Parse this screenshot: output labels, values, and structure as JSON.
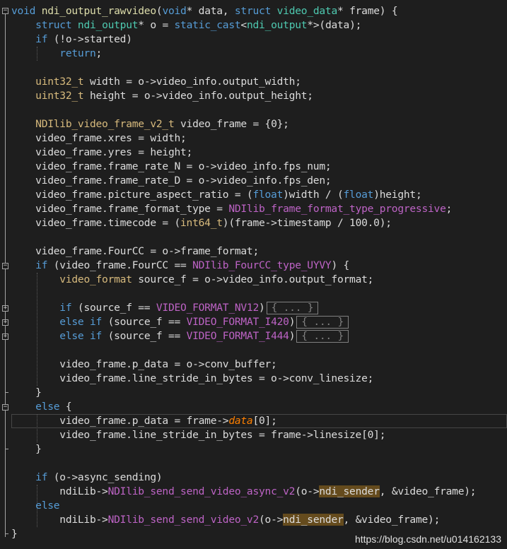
{
  "colors": {
    "background": "#1e1e1e",
    "keyword": "#569cd6",
    "type": "#4ec9b0",
    "function": "#dcdcaa",
    "member": "#dadada",
    "enum_constant": "#b8d7a3",
    "macro": "#bd63c5",
    "highlight": "#654b1d"
  },
  "icons": {
    "fold_expanded": "minus-square-icon",
    "fold_collapsed": "plus-square-icon"
  },
  "fold_glyphs": {
    "expanded": "−",
    "collapsed": "+"
  },
  "code": {
    "l1": {
      "a": "void",
      "b": " ndi_output_rawvideo",
      "c": "(",
      "d": "void",
      "e": "* data, ",
      "f": "struct",
      "g": " video_data",
      "h": "* frame) {"
    },
    "l2": {
      "a": "    ",
      "b": "struct",
      "c": " ",
      "d": "ndi_output",
      "e": "* o = ",
      "f": "static_cast",
      "g": "<",
      "h": "ndi_output",
      "i": "*>(data);"
    },
    "l3": {
      "a": "    ",
      "b": "if",
      "c": " (!o->started)"
    },
    "l4": {
      "a": "        ",
      "b": "return",
      "c": ";"
    },
    "l5": "",
    "l6": {
      "a": "    ",
      "b": "uint32_t",
      "c": " width = o->video_info.output_width;"
    },
    "l7": {
      "a": "    ",
      "b": "uint32_t",
      "c": " height = o->video_info.output_height;"
    },
    "l8": "",
    "l9": {
      "a": "    ",
      "b": "NDIlib_video_frame_v2_t",
      "c": " video_frame = {0};"
    },
    "l10": "    video_frame.xres = width;",
    "l11": "    video_frame.yres = height;",
    "l12": "    video_frame.frame_rate_N = o->video_info.fps_num;",
    "l13": "    video_frame.frame_rate_D = o->video_info.fps_den;",
    "l14": {
      "a": "    video_frame.picture_aspect_ratio = (",
      "b": "float",
      "c": ")width / (",
      "d": "float",
      "e": ")height;"
    },
    "l15": {
      "a": "    video_frame.frame_format_type = ",
      "b": "NDIlib_frame_format_type_progressive",
      "c": ";"
    },
    "l16": {
      "a": "    video_frame.timecode = (",
      "b": "int64_t",
      "c": ")(frame->timestamp / 100.0);"
    },
    "l17": "",
    "l18": "    video_frame.FourCC = o->frame_format;",
    "l19": {
      "a": "    ",
      "b": "if",
      "c": " (video_frame.FourCC == ",
      "d": "NDIlib_FourCC_type_UYVY",
      "e": ") {"
    },
    "l20": {
      "a": "        ",
      "b": "video_format",
      "c": " source_f = o->video_info.output_format;"
    },
    "l21": "",
    "l22": {
      "a": "        ",
      "b": "if",
      "c": " (source_f == ",
      "d": "VIDEO_FORMAT_NV12",
      "e": ")",
      "f": "{ ... }"
    },
    "l23": {
      "a": "        ",
      "b": "else if",
      "c": " (source_f == ",
      "d": "VIDEO_FORMAT_I420",
      "e": ")",
      "f": "{ ... }"
    },
    "l24": {
      "a": "        ",
      "b": "else if",
      "c": " (source_f == ",
      "d": "VIDEO_FORMAT_I444",
      "e": ")",
      "f": "{ ... }"
    },
    "l25": "",
    "l26": "        video_frame.p_data = o->conv_buffer;",
    "l27": "        video_frame.line_stride_in_bytes = o->conv_linesize;",
    "l28": "    }",
    "l29": {
      "a": "    ",
      "b": "else",
      "c": " {"
    },
    "l30": {
      "a": "        video_frame.p_data = frame->",
      "b": "data",
      "c": "[0];"
    },
    "l31": "        video_frame.line_stride_in_bytes = frame->linesize[0];",
    "l32": "    }",
    "l33": "",
    "l34": {
      "a": "    ",
      "b": "if",
      "c": " (o->async_sending)"
    },
    "l35": {
      "a": "        ndiLib->",
      "b": "NDIlib_send_send_video_async_v2",
      "c": "(o->",
      "d": "ndi_sender",
      "e": ", &video_frame);"
    },
    "l36": {
      "a": "    ",
      "b": "else"
    },
    "l37": {
      "a": "        ndiLib->",
      "b": "NDIlib_send_send_video_v2",
      "c": "(o->",
      "d": "ndi_sender",
      "e": ", &video_frame);"
    },
    "l38": "}"
  },
  "watermark": "https://blog.csdn.net/u014162133"
}
